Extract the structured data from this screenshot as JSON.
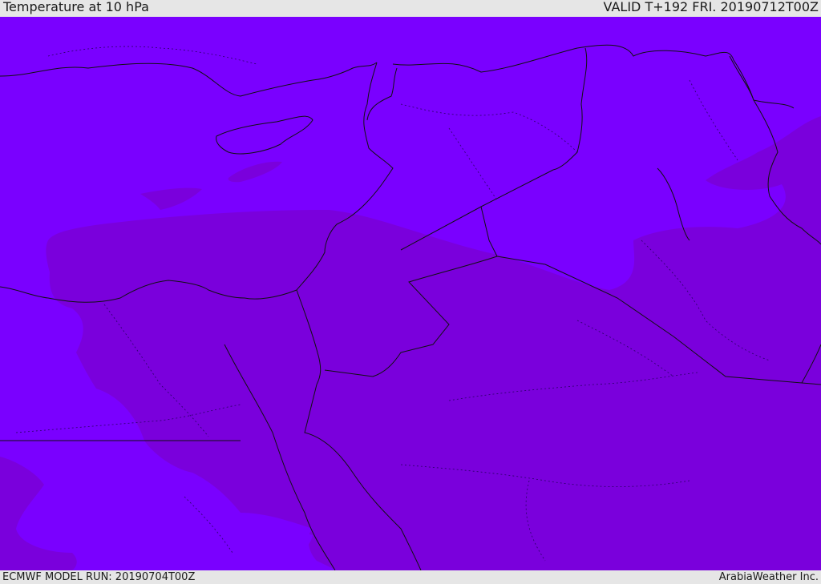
{
  "header": {
    "title": "Temperature at 10 hPa",
    "valid": "VALID T+192 FRI. 20190712T00Z"
  },
  "footer": {
    "model_run": "ECMWF MODEL RUN: 20190704T00Z",
    "brand": "ArabiaWeather Inc."
  },
  "map": {
    "colors": {
      "cold_band": "#7a00ff",
      "warm_band": "#7a00dc",
      "border": "#111111"
    }
  }
}
